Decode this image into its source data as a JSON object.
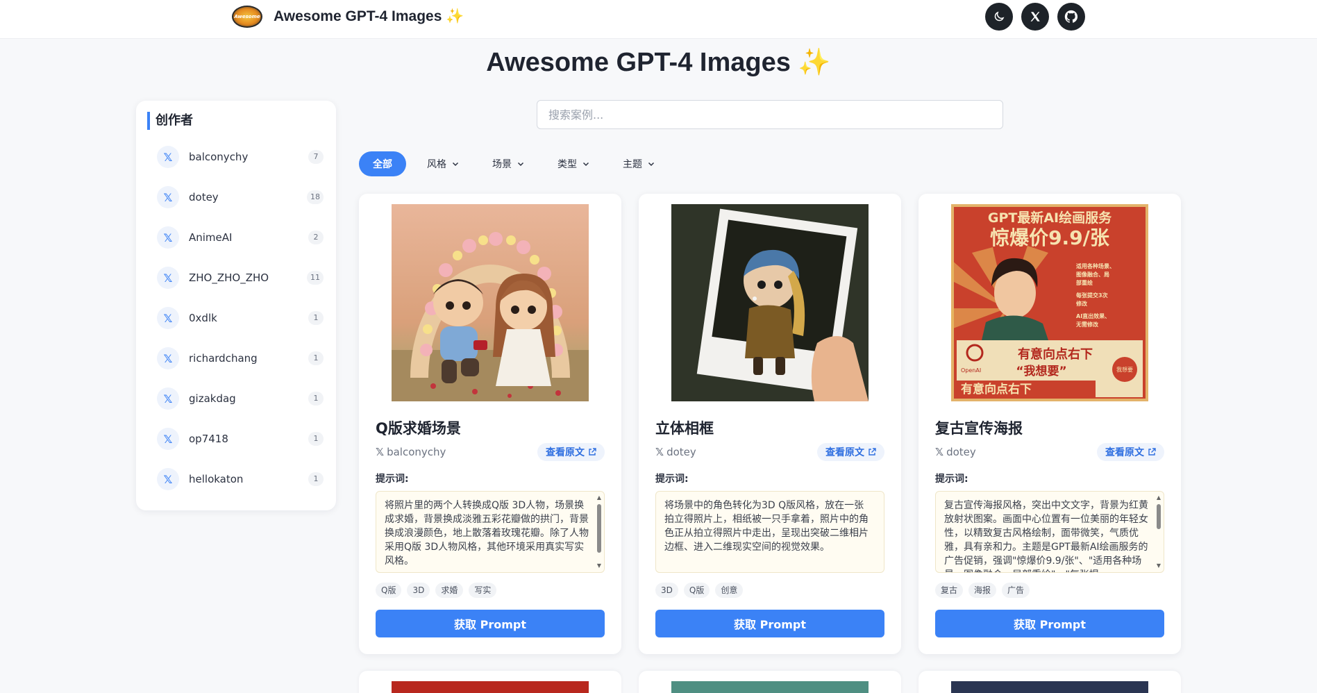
{
  "app": {
    "title": "Awesome GPT-4 Images ✨",
    "logo_text": "Awesome"
  },
  "header": {
    "actions": [
      {
        "name": "theme-toggle-button",
        "icon": "moon-icon"
      },
      {
        "name": "x-link-button",
        "icon": "x-logo-icon"
      },
      {
        "name": "github-link-button",
        "icon": "github-icon"
      }
    ]
  },
  "page": {
    "heading": "Awesome GPT-4 Images ✨"
  },
  "sidebar": {
    "title": "创作者",
    "creators": [
      {
        "name": "balconychy",
        "count": "7"
      },
      {
        "name": "dotey",
        "count": "18"
      },
      {
        "name": "AnimeAI",
        "count": "2"
      },
      {
        "name": "ZHO_ZHO_ZHO",
        "count": "11"
      },
      {
        "name": "0xdlk",
        "count": "1"
      },
      {
        "name": "richardchang",
        "count": "1"
      },
      {
        "name": "gizakdag",
        "count": "1"
      },
      {
        "name": "op7418",
        "count": "1"
      },
      {
        "name": "hellokaton",
        "count": "1"
      }
    ]
  },
  "search": {
    "placeholder": "搜索案例..."
  },
  "filters": {
    "all": "全部",
    "dropdowns": [
      "风格",
      "场景",
      "类型",
      "主题"
    ]
  },
  "cards": [
    {
      "title": "Q版求婚场景",
      "author": "balconychy",
      "source_label": "查看原文",
      "prompt_label": "提示词:",
      "prompt": "将照片里的两个人转换成Q版 3D人物，场景换成求婚，背景换成淡雅五彩花瓣做的拱门，背景换成浪漫颜色，地上散落着玫瑰花瓣。除了人物采用Q版 3D人物风格，其他环境采用真实写实风格。",
      "tags": [
        "Q版",
        "3D",
        "求婚",
        "写实"
      ],
      "button": "获取 Prompt"
    },
    {
      "title": "立体相框",
      "author": "dotey",
      "source_label": "查看原文",
      "prompt_label": "提示词:",
      "prompt": "将场景中的角色转化为3D Q版风格，放在一张拍立得照片上，相纸被一只手拿着，照片中的角色正从拍立得照片中走出，呈现出突破二维相片边框、进入二维现实空间的视觉效果。",
      "tags": [
        "3D",
        "Q版",
        "创意"
      ],
      "button": "获取 Prompt"
    },
    {
      "title": "复古宣传海报",
      "author": "dotey",
      "source_label": "查看原文",
      "prompt_label": "提示词:",
      "prompt": "复古宣传海报风格，突出中文文字，背景为红黄放射状图案。画面中心位置有一位美丽的年轻女性，以精致复古风格绘制，面带微笑，气质优雅，具有亲和力。主题是GPT最新AI绘画服务的广告促销，强调\"惊爆价9.9/张\"、\"适用各种场景、图像融合、局部重绘\"、\"每张提",
      "tags": [
        "复古",
        "海报",
        "广告"
      ],
      "button": "获取 Prompt",
      "poster": {
        "line1": "GPT最新AI绘画服务",
        "line2": "惊爆价9.9/张",
        "side": [
          "适用各种场景、",
          "图像融合、局",
          "部重绘",
          "每张提交3次",
          "修改",
          "AI直出效果、",
          "无需修改"
        ],
        "cta1": "有意向点右下",
        "cta2": "“我想要”",
        "brand": "OpenAI",
        "stamp": "我想要",
        "bottom": "有意向点右下"
      }
    }
  ],
  "colors": {
    "accent": "#3b82f6",
    "dark_button": "#1e2329",
    "background": "#f7f8fa"
  }
}
